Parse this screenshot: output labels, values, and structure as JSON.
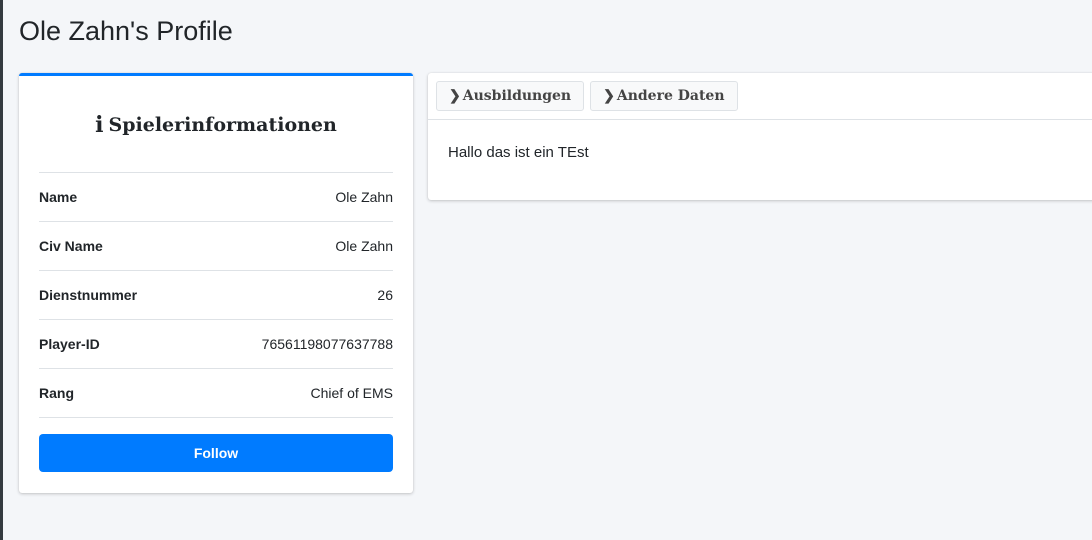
{
  "page": {
    "title": "Ole Zahn's Profile"
  },
  "profile_card": {
    "heading": "Spielerinformationen",
    "heading_icon": "info-icon",
    "rows": [
      {
        "label": "Name",
        "value": "Ole Zahn"
      },
      {
        "label": "Civ Name",
        "value": "Ole Zahn"
      },
      {
        "label": "Dienstnummer",
        "value": "26"
      },
      {
        "label": "Player-ID",
        "value": "76561198077637788"
      },
      {
        "label": "Rang",
        "value": "Chief of EMS"
      }
    ],
    "follow_label": "Follow"
  },
  "tabs": {
    "items": [
      {
        "label": "Ausbildungen",
        "icon": "chevron-right-icon"
      },
      {
        "label": "Andere Daten",
        "icon": "chevron-right-icon"
      }
    ],
    "content": "Hallo das ist ein TEst"
  },
  "colors": {
    "accent": "#007bff",
    "background": "#f4f6f9"
  }
}
